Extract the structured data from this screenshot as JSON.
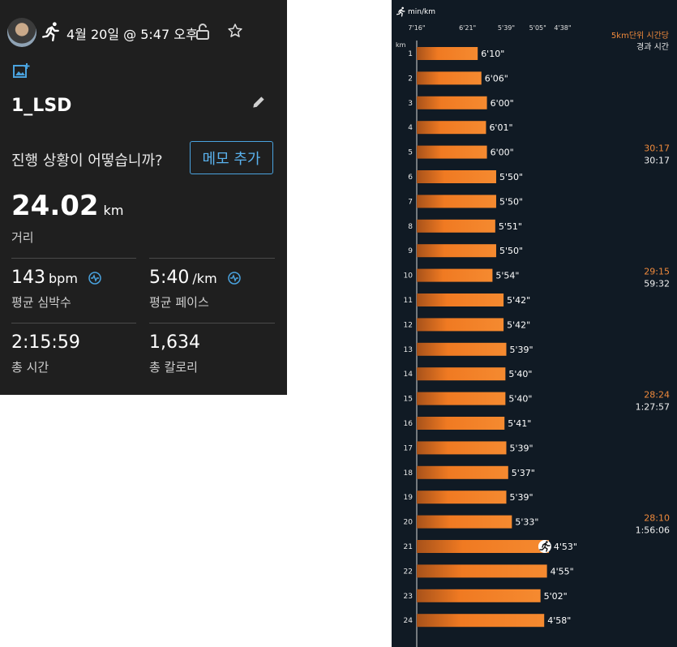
{
  "activity": {
    "date_text": "4월 20일 @ 5:47 오후",
    "title": "1_LSD",
    "question": "진행 상황이 어떻습니까?",
    "memo_button": "메모 추가",
    "distance": {
      "value": "24.02",
      "unit": "km",
      "label": "거리"
    },
    "heart_rate": {
      "value": "143",
      "unit": "bpm",
      "label": "평균 심박수"
    },
    "pace": {
      "value": "5:40",
      "unit": "/km",
      "label": "평균 페이스"
    },
    "total_time": {
      "value": "2:15:59",
      "label": "총 시간"
    },
    "calories": {
      "value": "1,634",
      "label": "총 칼로리"
    },
    "icons": [
      "avatar",
      "running-icon",
      "unlock-icon",
      "star-icon",
      "add-photo-icon",
      "pencil-icon",
      "chart-icon"
    ],
    "accent_color": "#4aa3df"
  },
  "split_chart": {
    "unit_label": "min/km",
    "km_header": "km",
    "legend_line1": "5km단위 시간당",
    "legend_line2": "경과 시간",
    "bar_color": "#f07a22",
    "legend_color": "#f08a3c"
  },
  "chart_data": {
    "type": "bar",
    "orientation": "horizontal",
    "ylabel": "km",
    "xlabel": "min/km",
    "x_ticks_labels": [
      "7'16\"",
      "6'21\"",
      "5'39\"",
      "5'05\"",
      "4'38\""
    ],
    "x_ticks_pace_seconds": [
      436,
      381,
      339,
      305,
      278
    ],
    "categories": [
      "1",
      "2",
      "3",
      "4",
      "5",
      "6",
      "7",
      "8",
      "9",
      "10",
      "11",
      "12",
      "13",
      "14",
      "15",
      "16",
      "17",
      "18",
      "19",
      "20",
      "21",
      "22",
      "23",
      "24"
    ],
    "value_labels": [
      "6'10\"",
      "6'06\"",
      "6'00\"",
      "6'01\"",
      "6'00\"",
      "5'50\"",
      "5'50\"",
      "5'51\"",
      "5'50\"",
      "5'54\"",
      "5'42\"",
      "5'42\"",
      "5'39\"",
      "5'40\"",
      "5'40\"",
      "5'41\"",
      "5'39\"",
      "5'37\"",
      "5'39\"",
      "5'33\"",
      "4'53\"",
      "4'55\"",
      "5'02\"",
      "4'58\""
    ],
    "values_seconds": [
      370,
      366,
      360,
      361,
      360,
      350,
      350,
      351,
      350,
      354,
      342,
      342,
      339,
      340,
      340,
      341,
      339,
      337,
      339,
      333,
      293,
      295,
      302,
      298
    ],
    "fastest_index": 20,
    "segment_summaries": [
      {
        "after_km": 5,
        "split": "30:17",
        "elapsed": "30:17"
      },
      {
        "after_km": 10,
        "split": "29:15",
        "elapsed": "59:32"
      },
      {
        "after_km": 15,
        "split": "28:24",
        "elapsed": "1:27:57"
      },
      {
        "after_km": 20,
        "split": "28:10",
        "elapsed": "1:56:06"
      }
    ]
  }
}
